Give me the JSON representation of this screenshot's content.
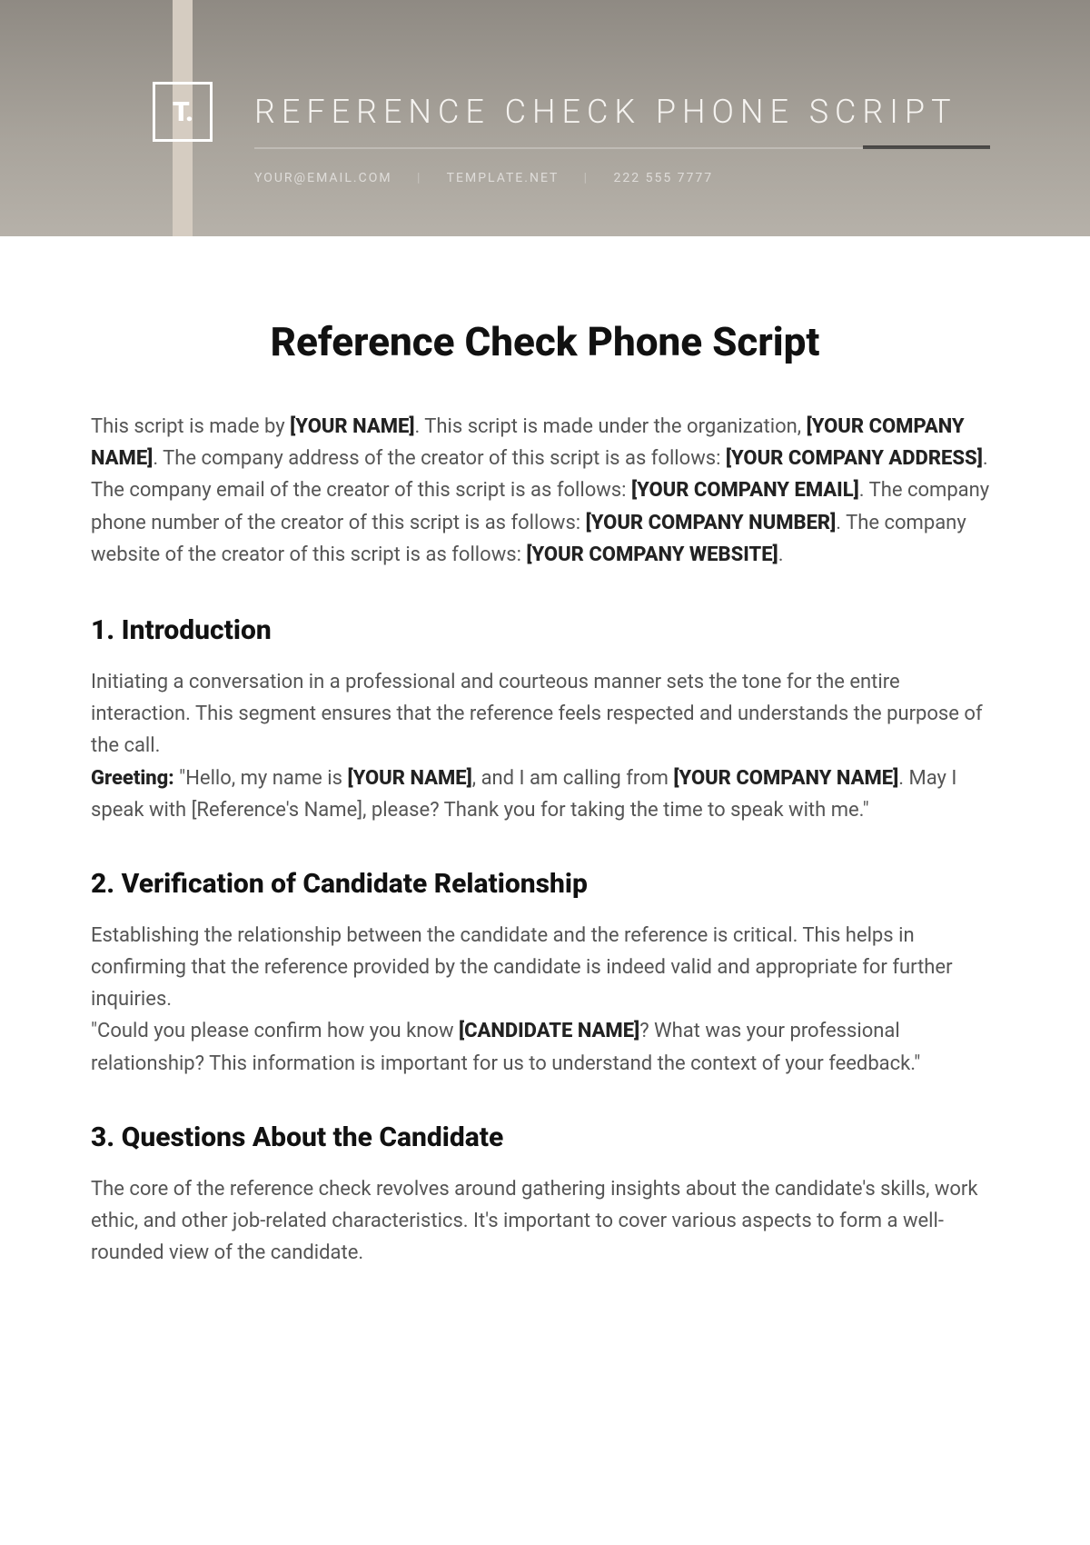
{
  "header": {
    "logo_text": "T.",
    "title": "REFERENCE CHECK PHONE SCRIPT",
    "email": "YOUR@EMAIL.COM",
    "website": "TEMPLATE.NET",
    "phone": "222 555 7777"
  },
  "doc": {
    "title": "Reference Check Phone Script",
    "intro_parts": {
      "t1": "This script is made by ",
      "b1": "[YOUR NAME]",
      "t2": ". This script is made under the organization, ",
      "b2": "[YOUR COMPANY NAME]",
      "t3": ". The company address of the creator of this script is as follows: ",
      "b3": "[YOUR COMPANY ADDRESS]",
      "t4": ". The company email of the creator of this script is as follows: ",
      "b4": "[YOUR COMPANY EMAIL]",
      "t5": ". The company phone number of the creator of this script is as follows: ",
      "b5": "[YOUR COMPANY NUMBER]",
      "t6": ". The company website of the creator of this script is as follows: ",
      "b6": "[YOUR COMPANY WEBSITE]",
      "t7": "."
    },
    "sections": [
      {
        "title": "1. Introduction",
        "p1": "Initiating a conversation in a professional and courteous manner sets the tone for the entire interaction. This segment ensures that the reference feels respected and understands the purpose of the call.",
        "greeting_label": "Greeting:",
        "g1": " \"Hello, my name is ",
        "gb1": "[YOUR NAME]",
        "g2": ", and I am calling from ",
        "gb2": "[YOUR COMPANY NAME]",
        "g3": ". May I speak with [Reference's Name], please? Thank you for taking the time to speak with me.\""
      },
      {
        "title": "2. Verification of Candidate Relationship",
        "p1": "Establishing the relationship between the candidate and the reference is critical. This helps in confirming that the reference provided by the candidate is indeed valid and appropriate for further inquiries.",
        "q1": "\"Could you please confirm how you know ",
        "qb1": "[CANDIDATE NAME]",
        "q2": "? What was your professional relationship? This information is important for us to understand the context of your feedback.\""
      },
      {
        "title": "3. Questions About the Candidate",
        "p1": "The core of the reference check revolves around gathering insights about the candidate's skills, work ethic, and other job-related characteristics. It's important to cover various aspects to form a well-rounded view of the candidate."
      }
    ]
  }
}
